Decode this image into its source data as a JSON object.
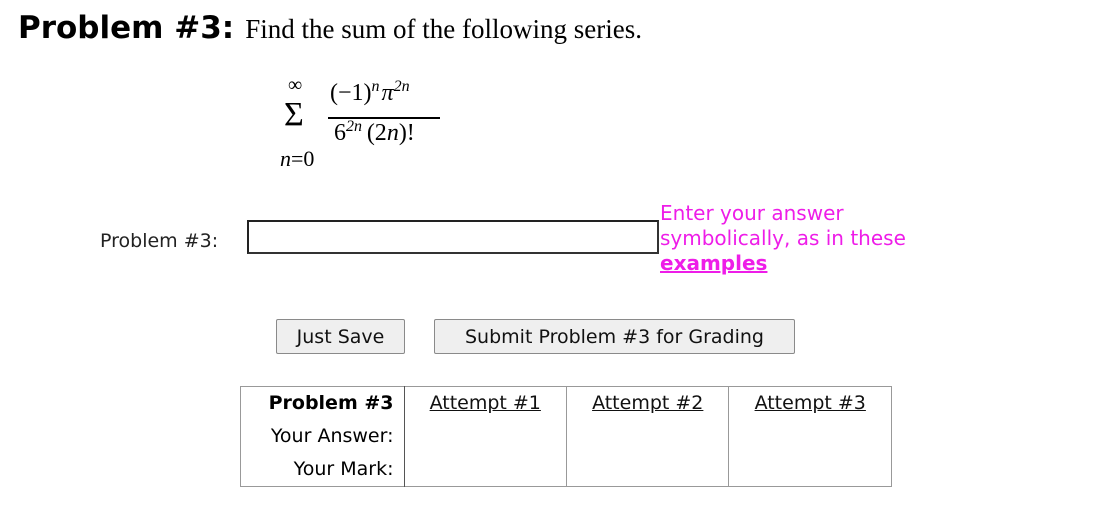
{
  "header": {
    "label": "Problem #3:",
    "text": "Find the sum of the following series."
  },
  "formula": {
    "upper_limit": "∞",
    "sigma": "Σ",
    "lower_var": "n",
    "lower_eq": "=0",
    "numer_base": "(−1)",
    "numer_exp": "n",
    "numer_pi": "π",
    "numer_pi_exp": "2n",
    "denom_base": "6",
    "denom_exp": "2n",
    "denom_paren_open": "(2",
    "denom_var": "n",
    "denom_paren_close": ")!"
  },
  "answer": {
    "label": "Problem #3:",
    "value": "",
    "placeholder": ""
  },
  "hint": {
    "line1": "Enter your answer",
    "line2": "symbolically, as in these",
    "link": "examples"
  },
  "buttons": {
    "save": "Just Save",
    "submit": "Submit Problem #3 for Grading"
  },
  "attempts_table": {
    "header": "Problem #3",
    "attempts": [
      "Attempt #1",
      "Attempt #2",
      "Attempt #3"
    ],
    "row_answer": "Your Answer:",
    "row_mark": "Your Mark:"
  }
}
